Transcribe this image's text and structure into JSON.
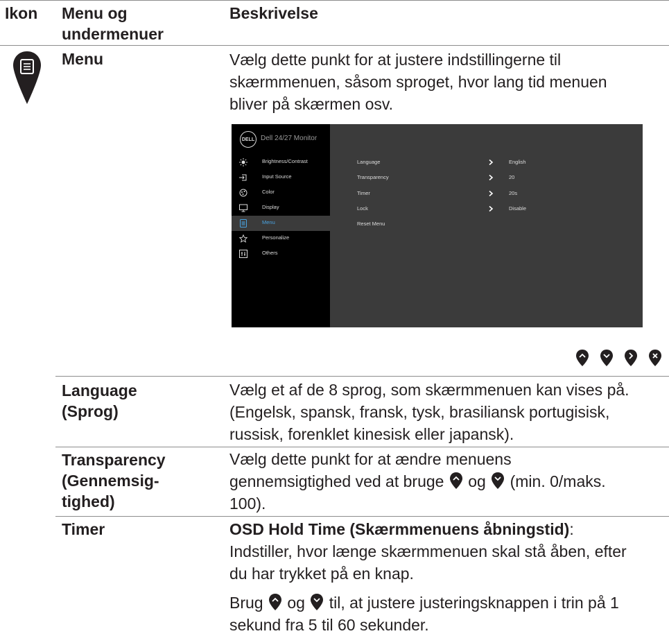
{
  "header": {
    "col_icon": "Ikon",
    "col_menu_line1": "Menu og",
    "col_menu_line2": "undermenuer",
    "col_desc": "Beskrivelse"
  },
  "menu_row": {
    "icon": "menu-list-icon",
    "label": "Menu",
    "desc_lines": [
      "Vælg dette punkt for at justere indstillingerne til",
      "skærmmenuen, såsom sproget, hvor lang tid menuen",
      "bliver på skærmen osv."
    ]
  },
  "osd": {
    "logo": "DELL",
    "title": "Dell 24/27 Monitor",
    "sidebar": [
      {
        "label": "Brightness/Contrast",
        "icon": "brightness-icon"
      },
      {
        "label": "Input Source",
        "icon": "input-source-icon"
      },
      {
        "label": "Color",
        "icon": "color-icon"
      },
      {
        "label": "Display",
        "icon": "display-icon"
      },
      {
        "label": "Menu",
        "icon": "menu-icon",
        "selected": true
      },
      {
        "label": "Personalize",
        "icon": "star-icon"
      },
      {
        "label": "Others",
        "icon": "others-icon"
      }
    ],
    "settings": [
      {
        "label": "Language",
        "value": "English"
      },
      {
        "label": "Transparency",
        "value": "20"
      },
      {
        "label": "Timer",
        "value": "20s"
      },
      {
        "label": "Lock",
        "value": "Disable"
      },
      {
        "label": "Reset Menu",
        "value": ""
      }
    ],
    "colors": {
      "sidebar_bg": "#000000",
      "panel_bg": "#3b3b3b",
      "selected_text": "#4aa3e0"
    }
  },
  "nav_buttons": [
    "up-button-icon",
    "down-button-icon",
    "right-button-icon",
    "close-button-icon"
  ],
  "rows": {
    "language": {
      "label1": "Language",
      "label2": "(Sprog)",
      "desc_lines": [
        "Vælg et af de 8 sprog, som skærmmenuen kan vises på.",
        "(Engelsk, spansk, fransk, tysk, brasiliansk portugisisk,",
        "russisk, forenklet kinesisk eller japansk)."
      ]
    },
    "transparency": {
      "label1": "Transparency",
      "label2": "(Gennemsig-",
      "label3": "tighed)",
      "desc_line1": "Vælg dette punkt for at ændre menuens",
      "desc_line2_pre": "gennemsigtighed ved at bruge",
      "desc_line2_mid": "og",
      "desc_line2_post": "(min. 0/maks.",
      "desc_line3": "100)."
    },
    "timer": {
      "label": "Timer",
      "desc_bold": "OSD Hold Time (Skærmmenuens åbningstid)",
      "desc_colon": ":",
      "desc_lines": [
        "Indstiller, hvor længe skærmmenuen skal stå åben, efter",
        "du har trykket på en knap."
      ],
      "desc2_pre": "Brug",
      "desc2_mid": "og",
      "desc2_post": "til, at justere justeringsknappen i trin på 1",
      "desc2_line2": "sekund fra 5 til 60 sekunder."
    }
  }
}
